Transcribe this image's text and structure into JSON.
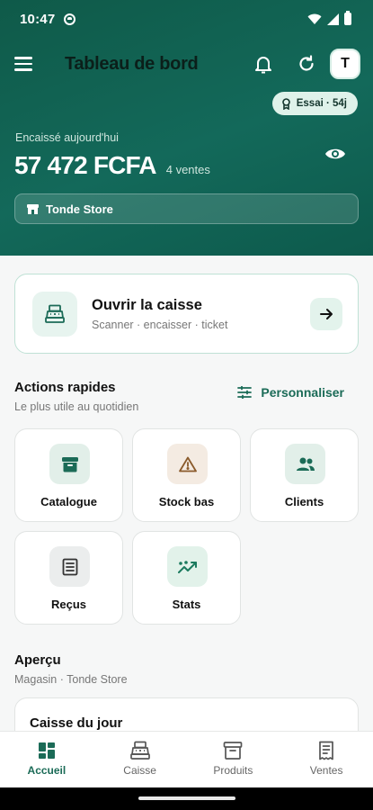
{
  "status_bar": {
    "time": "10:47"
  },
  "header": {
    "title": "Tableau de bord",
    "avatar_initial": "T",
    "trial_badge": "Essai · 54j",
    "collected_label": "Encaissé aujourd'hui",
    "amount": "57 472 FCFA",
    "sales_count": "4 ventes",
    "store_name": "Tonde Store"
  },
  "register_card": {
    "title": "Ouvrir la caisse",
    "subtitle": "Scanner · encaisser · ticket"
  },
  "quick_actions": {
    "title": "Actions rapides",
    "subtitle": "Le plus utile au quotidien",
    "customize_label": "Personnaliser",
    "tiles": [
      {
        "label": "Catalogue",
        "icon": "archive-icon",
        "tint": "#e2efe9"
      },
      {
        "label": "Stock bas",
        "icon": "warning-icon",
        "tint": "#f4ebe2"
      },
      {
        "label": "Clients",
        "icon": "users-icon",
        "tint": "#e2efe9"
      },
      {
        "label": "Reçus",
        "icon": "receipt-icon",
        "tint": "#ebeded"
      },
      {
        "label": "Stats",
        "icon": "trending-icon",
        "tint": "#e2f2ea"
      }
    ]
  },
  "overview": {
    "title": "Aperçu",
    "subtitle": "Magasin · Tonde Store",
    "day_card_title": "Caisse du jour"
  },
  "bottom_nav": {
    "items": [
      {
        "label": "Accueil",
        "icon": "dashboard-icon",
        "active": true
      },
      {
        "label": "Caisse",
        "icon": "cash-register-icon",
        "active": false
      },
      {
        "label": "Produits",
        "icon": "box-icon",
        "active": false
      },
      {
        "label": "Ventes",
        "icon": "receipt-icon",
        "active": false
      }
    ]
  },
  "colors": {
    "header_gradient": "#13695a",
    "accent": "#1b6b57",
    "warning": "#8a5a2b"
  }
}
